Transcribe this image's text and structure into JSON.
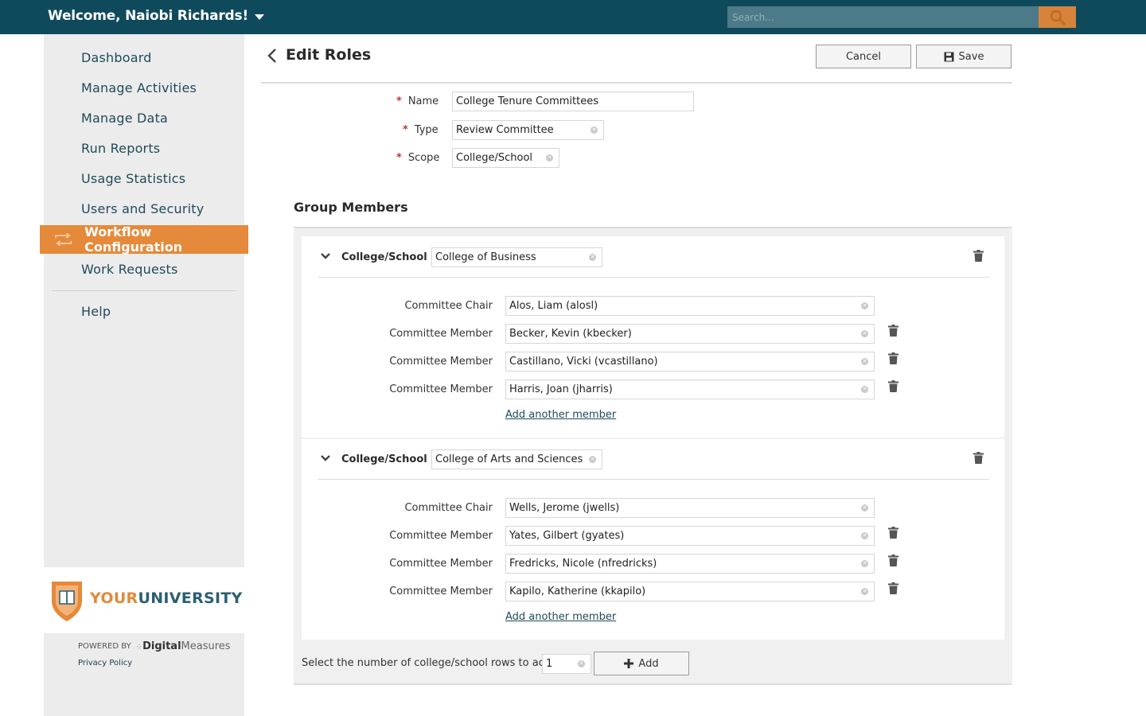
{
  "header": {
    "welcome": "Welcome, Naiobi Richards!",
    "search_placeholder": "Search..."
  },
  "sidebar": {
    "items": [
      {
        "label": "Dashboard"
      },
      {
        "label": "Manage Activities"
      },
      {
        "label": "Manage Data"
      },
      {
        "label": "Run Reports"
      },
      {
        "label": "Usage Statistics"
      },
      {
        "label": "Users and Security"
      },
      {
        "label": "Workflow Configuration",
        "active": true
      },
      {
        "label": "Work Requests"
      },
      {
        "label": "Help"
      }
    ],
    "logo": {
      "your": "YOUR",
      "university": "UNIVERSITY"
    },
    "powered_by": "POWERED BY",
    "vendor_bold": "Digital",
    "vendor_light": "Measures",
    "privacy": "Privacy Policy"
  },
  "page": {
    "title": "Edit Roles",
    "cancel_label": "Cancel",
    "save_label": "Save"
  },
  "form": {
    "name_label": "Name",
    "name_value": "College Tenure Committees",
    "type_label": "Type",
    "type_value": "Review Committee",
    "scope_label": "Scope",
    "scope_value": "College/School",
    "required_mark": "*"
  },
  "group_members": {
    "title": "Group Members",
    "groups": [
      {
        "scope_label": "College/School",
        "scope_value": "College of Business",
        "members": [
          {
            "role": "Committee Chair",
            "value": "Alos, Liam (alosl)"
          },
          {
            "role": "Committee Member",
            "value": "Becker, Kevin (kbecker)"
          },
          {
            "role": "Committee Member",
            "value": "Castillano, Vicki (vcastillano)"
          },
          {
            "role": "Committee Member",
            "value": "Harris, Joan (jharris)"
          }
        ],
        "add_member": "Add another member"
      },
      {
        "scope_label": "College/School",
        "scope_value": "College of Arts and Sciences",
        "members": [
          {
            "role": "Committee Chair",
            "value": "Wells, Jerome (jwells)"
          },
          {
            "role": "Committee Member",
            "value": "Yates, Gilbert (gyates)"
          },
          {
            "role": "Committee Member",
            "value": "Fredricks, Nicole (nfredricks)"
          },
          {
            "role": "Committee Member",
            "value": "Kapilo, Katherine (kkapilo)"
          }
        ],
        "add_member": "Add another member"
      }
    ],
    "rows_prompt": "Select the number of college/school rows to add:",
    "rows_value": "1",
    "add_label": "Add"
  },
  "colors": {
    "topbar": "#0f4a5c",
    "accent": "#e58a3a",
    "required": "#c0392b"
  }
}
